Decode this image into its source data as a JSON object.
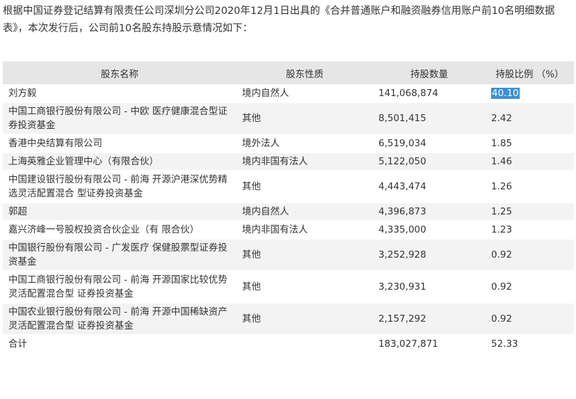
{
  "intro": "根据中国证券登记结算有限责任公司深圳分公司2020年12月1日出具的《合并普通账户和融资融券信用账户前10名明细数据表》，本次发行后，公司前10名股东持股示意情况如下：",
  "table": {
    "headers": [
      "股东名称",
      "股东性质",
      "持股数量",
      "持股比例 （%）"
    ],
    "rows": [
      {
        "name": "刘方毅",
        "type": "境内自然人",
        "shares": "141,068,874",
        "ratio": "40.10"
      },
      {
        "name": "中国工商银行股份有限公司 - 中欧 医疗健康混合型证券投资基金",
        "type": "其他",
        "shares": "8,501,415",
        "ratio": "2.42"
      },
      {
        "name": "香港中央结算有限公司",
        "type": "境外法人",
        "shares": "6,519,034",
        "ratio": "1.85"
      },
      {
        "name": "上海英雅企业管理中心（有限合伙）",
        "type": "境内非国有法人",
        "shares": "5,122,050",
        "ratio": "1.46"
      },
      {
        "name": "中国建设银行股份有限公司 - 前海 开源沪港深优势精选灵活配置混合 型证券投资基金",
        "type": "其他",
        "shares": "4,443,474",
        "ratio": "1.26"
      },
      {
        "name": "郭超",
        "type": "境内自然人",
        "shares": "4,396,873",
        "ratio": "1.25"
      },
      {
        "name": "嘉兴济峰一号股权投资合伙企业（有 限合伙）",
        "type": "境内非国有法人",
        "shares": "4,335,000",
        "ratio": "1.23"
      },
      {
        "name": "中国银行股份有限公司 - 广发医疗 保健股票型证券投资基金",
        "type": "其他",
        "shares": "3,252,928",
        "ratio": "0.92"
      },
      {
        "name": "中国工商银行股份有限公司 - 前海 开源国家比较优势灵活配置混合型 证券投资基金",
        "type": "其他",
        "shares": "3,230,931",
        "ratio": "0.92"
      },
      {
        "name": "中国农业银行股份有限公司 - 前海 开源中国稀缺资产灵活配置混合型 证券投资基金",
        "type": "其他",
        "shares": "2,157,292",
        "ratio": "0.92"
      }
    ],
    "total": {
      "name": "合计",
      "type": "",
      "shares": "183,027,871",
      "ratio": "52.33"
    }
  },
  "selection": {
    "row": 0,
    "column": "ratio",
    "color": "#3a8fd6"
  }
}
